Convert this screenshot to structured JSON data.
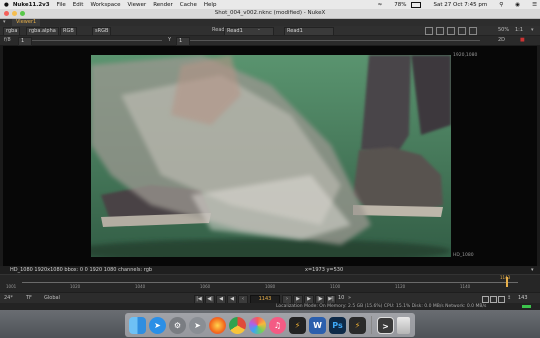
{
  "menubar": {
    "app": "Nuke11.2v3",
    "items": [
      "File",
      "Edit",
      "Workspace",
      "Viewer",
      "Render",
      "Cache",
      "Help"
    ],
    "battery": "78%",
    "datetime": "Sat 27 Oct  7:45 pm"
  },
  "window": {
    "title": "Shot_004_v002.nknc (modified) - NukeX"
  },
  "tabs": [
    {
      "label": "Viewer1"
    }
  ],
  "toolbar1": {
    "channels": "rgba",
    "alpha": "rgba.alpha",
    "colorspace": "RGB",
    "lut": "sRGB",
    "input_a": "Read1",
    "input_sep": "-",
    "input_b": "Read1",
    "zoom": "50%",
    "ratio": "1:1"
  },
  "toolbar2": {
    "f_label": "f/8",
    "f_value": "1",
    "y_label": "Y",
    "y_value": "1",
    "proxy": "2D"
  },
  "viewer": {
    "format_top_right": "1920,1080",
    "format_bottom_right": "HD_1080"
  },
  "status": {
    "info": "HD_1080 1920x1080  bbox: 0 0 1920 1080 channels: rgb",
    "coords": "x=1973 y=530"
  },
  "timeline": {
    "ticks": [
      "1001",
      "1020",
      "1040",
      "1060",
      "1080",
      "1100",
      "1120",
      "1140"
    ],
    "current": "1143"
  },
  "playbar": {
    "fps": "24*",
    "tf": "TF",
    "range": "Global",
    "frame": "1143",
    "step": "10",
    "end": "143"
  },
  "statsbar": {
    "text": "Localization Mode: On  Memory: 2.5 GB (15.6%)  CPU: 15.1%  Disk: 0.0 MB/s  Network: 0.0 MB/s"
  },
  "dock": {
    "icons": [
      "finder-icon",
      "safari-icon",
      "system-preferences-icon",
      "launchpad-icon",
      "firefox-icon",
      "chrome-icon",
      "photos-icon",
      "music-icon",
      "nuke-icon",
      "word-icon",
      "photoshop-icon",
      "nuke-icon-2",
      "maps-icon",
      "terminal-icon",
      "trash-icon"
    ],
    "word_letter": "W",
    "ps_letters": "Ps"
  },
  "colors": {
    "accent": "#e8b04a",
    "greenscreen": "#4a8a66",
    "dock_bg": "#d2d2d7"
  }
}
